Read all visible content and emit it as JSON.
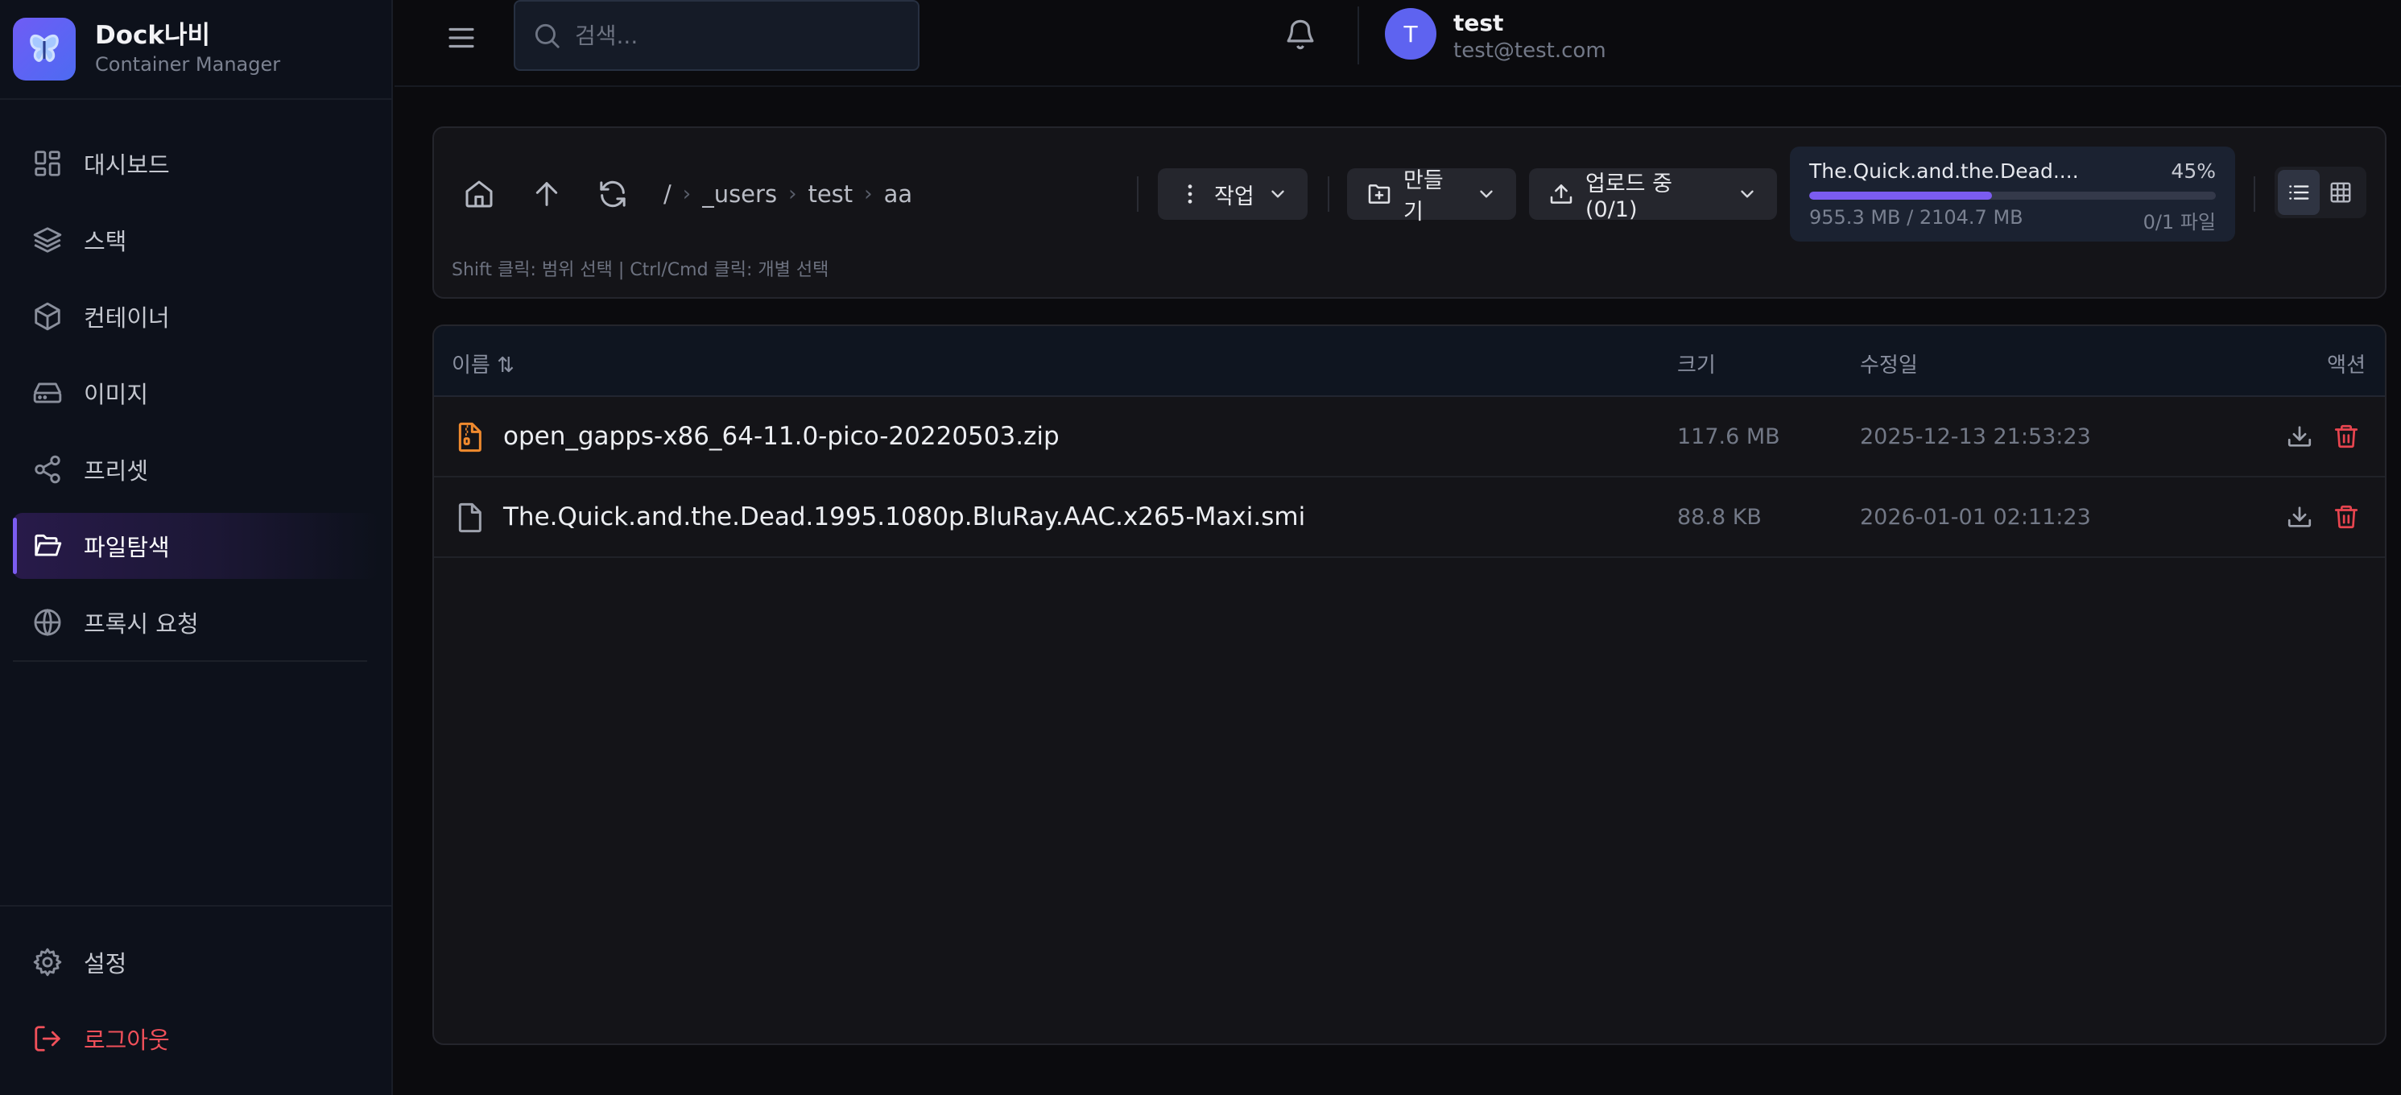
{
  "brand": {
    "name": "Dock나비",
    "subtitle": "Container Manager"
  },
  "sidebar": {
    "items": [
      {
        "label": "대시보드",
        "icon": "dashboard-icon"
      },
      {
        "label": "스택",
        "icon": "layers-icon"
      },
      {
        "label": "컨테이너",
        "icon": "box-icon"
      },
      {
        "label": "이미지",
        "icon": "hard-drive-icon"
      },
      {
        "label": "프리셋",
        "icon": "share-icon"
      },
      {
        "label": "파일탐색",
        "icon": "folder-open-icon",
        "active": true
      },
      {
        "label": "프록시 요청",
        "icon": "globe-icon"
      }
    ],
    "bottom": [
      {
        "label": "설정",
        "icon": "gear-icon"
      },
      {
        "label": "로그아웃",
        "icon": "logout-icon"
      }
    ]
  },
  "topbar": {
    "search_placeholder": "검색...",
    "user": {
      "initial": "T",
      "name": "test",
      "email": "test@test.com"
    }
  },
  "toolbar": {
    "breadcrumb": [
      "/",
      "_users",
      "test",
      "aa"
    ],
    "actions_label": "작업",
    "create_label": "만들기",
    "upload_label": "업로드 중 (0/1)",
    "upload_progress": {
      "file_name": "The.Quick.and.the.Dead....",
      "percent": 45,
      "percent_label": "45%",
      "size_label": "955.3 MB / 2104.7 MB",
      "count_label": "0/1 파일"
    },
    "view_mode": "list",
    "hint": "Shift 클릭: 범위 선택 | Ctrl/Cmd 클릭: 개별 선택"
  },
  "table": {
    "headers": {
      "name": "이름 ⇅",
      "size": "크기",
      "modified": "수정일",
      "actions": "액션"
    },
    "rows": [
      {
        "name": "open_gapps-x86_64-11.0-pico-20220503.zip",
        "size": "117.6 MB",
        "modified": "2025-12-13 21:53:23",
        "type": "zip"
      },
      {
        "name": "The.Quick.and.the.Dead.1995.1080p.BluRay.AAC.x265-Maxi.smi",
        "size": "88.8 KB",
        "modified": "2026-01-01 02:11:23",
        "type": "file"
      }
    ]
  },
  "colors": {
    "accent": "#7b5cf0",
    "danger": "#e8454f",
    "zip": "#f08a2e"
  }
}
